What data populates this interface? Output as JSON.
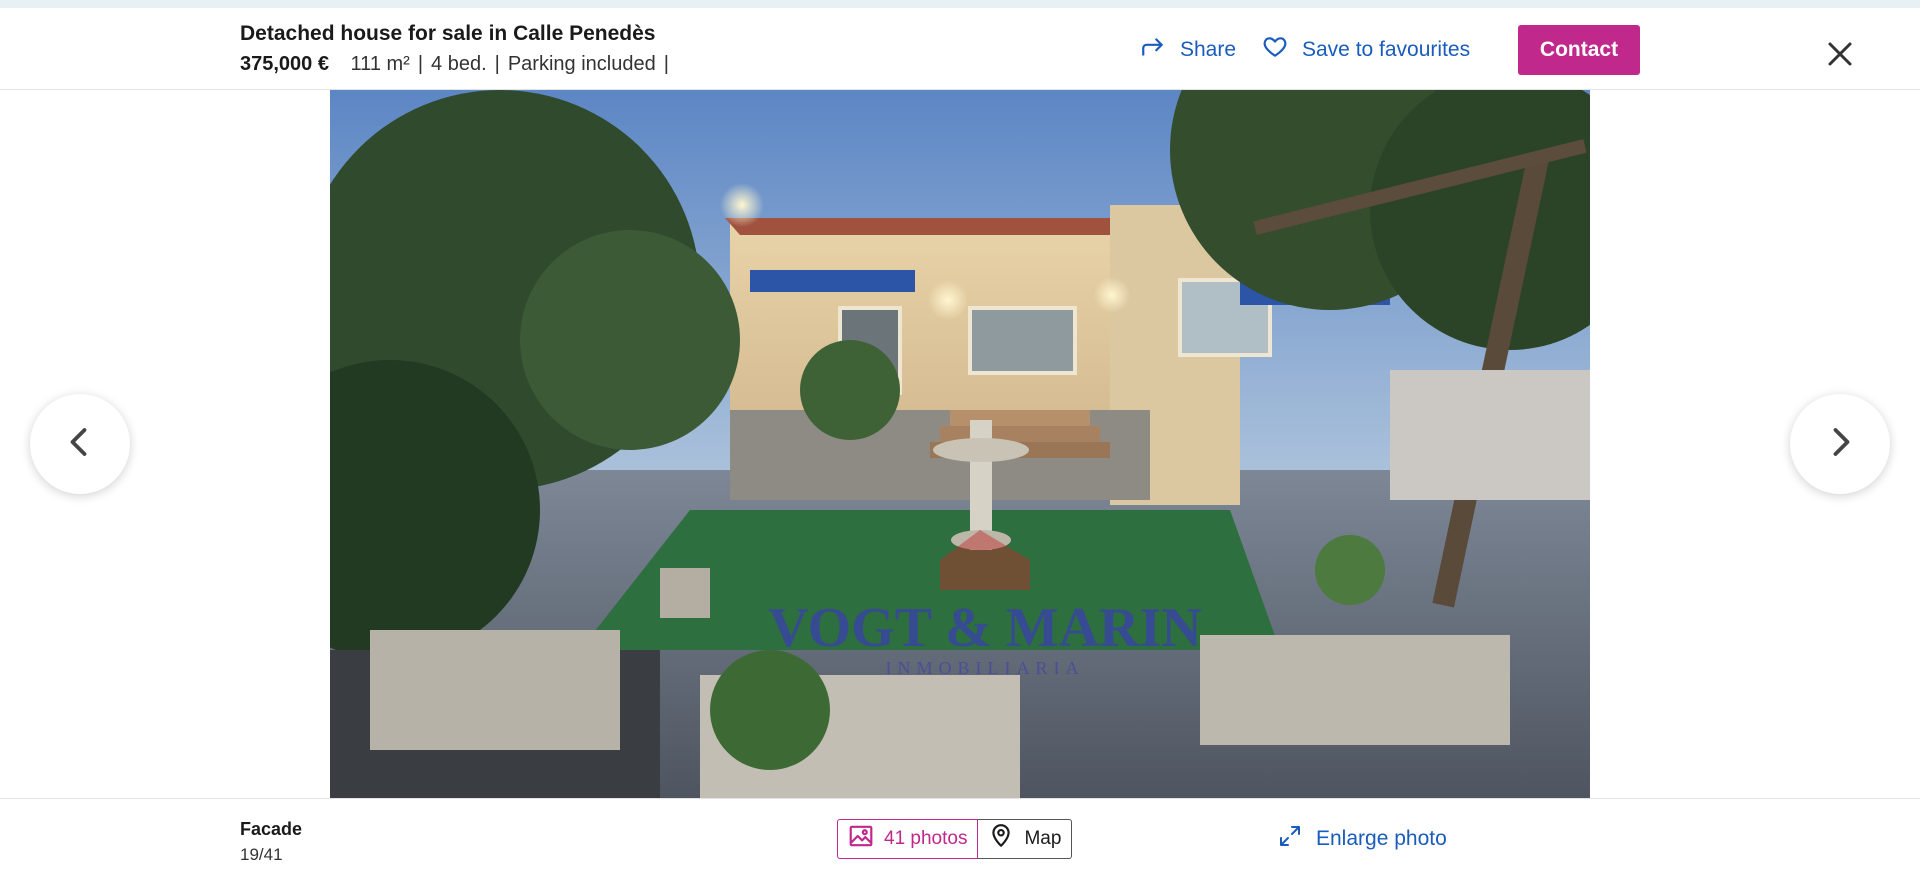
{
  "header": {
    "title": "Detached house for sale in Calle Penedès",
    "price": "375,000 €",
    "features": [
      "111 m²",
      "4 bed.",
      "Parking included"
    ],
    "share_label": "Share",
    "favourite_label": "Save to favourites",
    "contact_label": "Contact"
  },
  "photo": {
    "watermark": "VOGT & MARIN",
    "watermark_sub": "INMOBILIARIA"
  },
  "footer": {
    "caption": "Facade",
    "counter": "19/41",
    "photos_tab": "41 photos",
    "map_tab": "Map",
    "enlarge_label": "Enlarge photo"
  },
  "colors": {
    "accent": "#c0288b",
    "link": "#1a5cbc"
  },
  "icons": [
    "share-icon",
    "heart-icon",
    "close-icon",
    "chevron-left-icon",
    "chevron-right-icon",
    "image-icon",
    "map-pin-icon",
    "expand-icon"
  ]
}
